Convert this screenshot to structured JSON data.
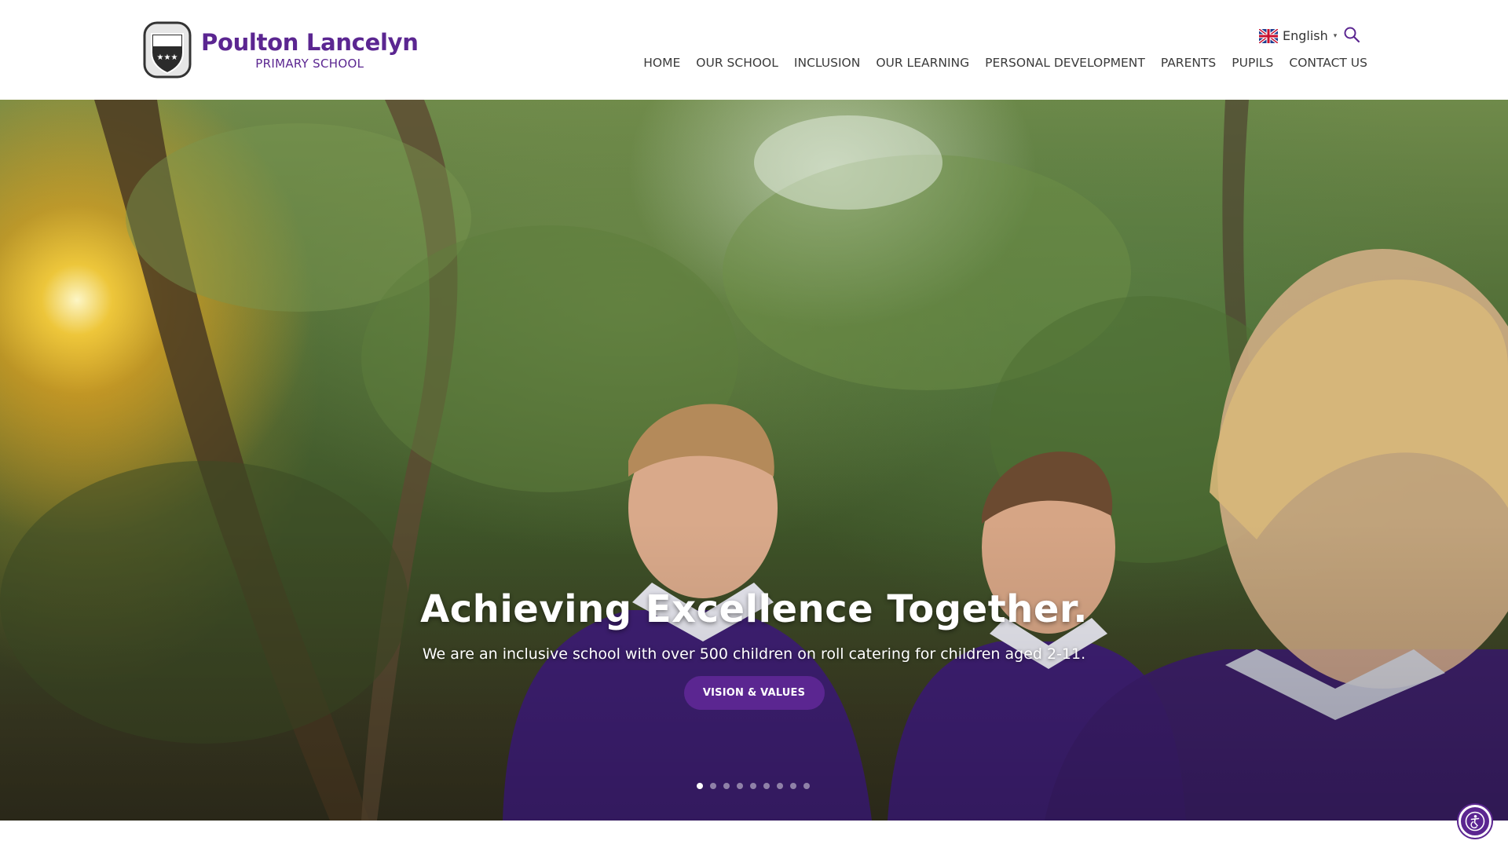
{
  "brand": {
    "name": "Poulton Lancelyn",
    "subtitle": "PRIMARY SCHOOL"
  },
  "language": {
    "label": "English",
    "flag_icon": "uk-flag-icon",
    "caret": "▾"
  },
  "search": {
    "icon": "search-icon"
  },
  "nav": {
    "items": [
      "HOME",
      "OUR SCHOOL",
      "INCLUSION",
      "OUR LEARNING",
      "PERSONAL DEVELOPMENT",
      "PARENTS",
      "PUPILS",
      "CONTACT US"
    ]
  },
  "hero": {
    "title": "Achieving Excellence Together.",
    "text": "We are an inclusive school with over 500 children on roll catering for children aged 2-11.",
    "button_label": "VISION & VALUES",
    "slide_count": 9,
    "active_slide": 1
  },
  "accessibility": {
    "icon": "accessibility-icon"
  },
  "colors": {
    "brand_purple": "#5b2691",
    "nav_text": "#3b3b3b",
    "white": "#ffffff"
  }
}
